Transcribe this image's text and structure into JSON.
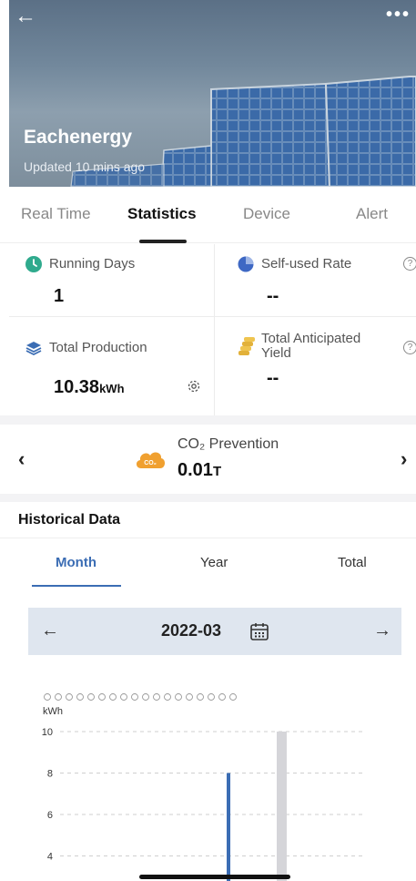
{
  "header": {
    "site_name": "Eachenergy",
    "updated": "Updated 10 mins ago",
    "back_icon": "arrow-left-icon",
    "more_icon": "more-horizontal-icon"
  },
  "tabs": [
    {
      "label": "Real Time",
      "active": false
    },
    {
      "label": "Statistics",
      "active": true
    },
    {
      "label": "Device",
      "active": false
    },
    {
      "label": "Alert",
      "active": false
    }
  ],
  "stats": {
    "running_days": {
      "label": "Running Days",
      "value": "1",
      "icon": "clock-icon"
    },
    "self_used_rate": {
      "label": "Self-used Rate",
      "value": "--",
      "icon": "pie-chart-icon"
    },
    "total_production": {
      "label": "Total Production",
      "value": "10.38",
      "unit": "kWh",
      "icon": "layers-icon"
    },
    "total_anticipated_yield": {
      "label": "Total Anticipated Yield",
      "value": "--",
      "icon": "coins-icon"
    }
  },
  "co2": {
    "label": "CO₂ Prevention",
    "value": "0.01",
    "unit": "T",
    "icon_text": "CO₂"
  },
  "historical": {
    "title": "Historical Data",
    "ranges": [
      {
        "label": "Month",
        "active": true
      },
      {
        "label": "Year",
        "active": false
      },
      {
        "label": "Total",
        "active": false
      }
    ],
    "date": "2022-03"
  },
  "colors": {
    "accent": "#3b6db4",
    "bar_gray": "#d5d5d9",
    "co2_orange": "#f0a030",
    "green_icon": "#2faa8d",
    "gold_icon": "#e2b13a"
  },
  "chart_data": {
    "type": "bar",
    "ylabel": "kWh",
    "yticks": [
      4,
      6,
      8,
      10
    ],
    "ylim": [
      3.5,
      10.5
    ],
    "series": [
      {
        "values": [
          8
        ]
      },
      {
        "values": [
          10
        ]
      }
    ]
  }
}
